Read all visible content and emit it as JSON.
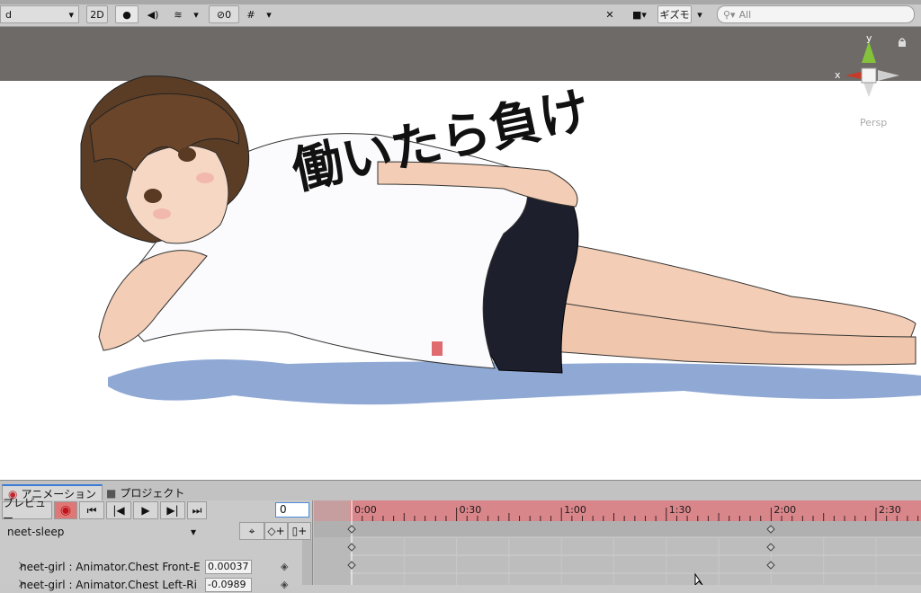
{
  "toolbar": {
    "shading_mode": "d",
    "mode_2d": "2D",
    "hidden_objects_count": "0",
    "gizmos_label": "ギズモ",
    "search_placeholder": "All"
  },
  "scene": {
    "axis_x": "x",
    "axis_y": "y",
    "projection_label": "Persp",
    "shirt_text": "働いたら負け"
  },
  "animation_panel": {
    "tabs": [
      {
        "label": "アニメーション",
        "icon": "record-icon"
      },
      {
        "label": "プロジェクト",
        "icon": "folder-icon"
      }
    ],
    "preview_label": "プレビュー",
    "current_frame": "0",
    "clip_name": "neet-sleep",
    "properties": [
      {
        "name": "neet-girl : Animator.Chest Front-E",
        "value": "0.00037"
      },
      {
        "name": "neet-girl : Animator.Chest Left-Ri",
        "value": "-0.0989"
      }
    ],
    "time_labels": [
      "0:00",
      "0:30",
      "1:00",
      "1:30",
      "2:00",
      "2:30"
    ]
  }
}
